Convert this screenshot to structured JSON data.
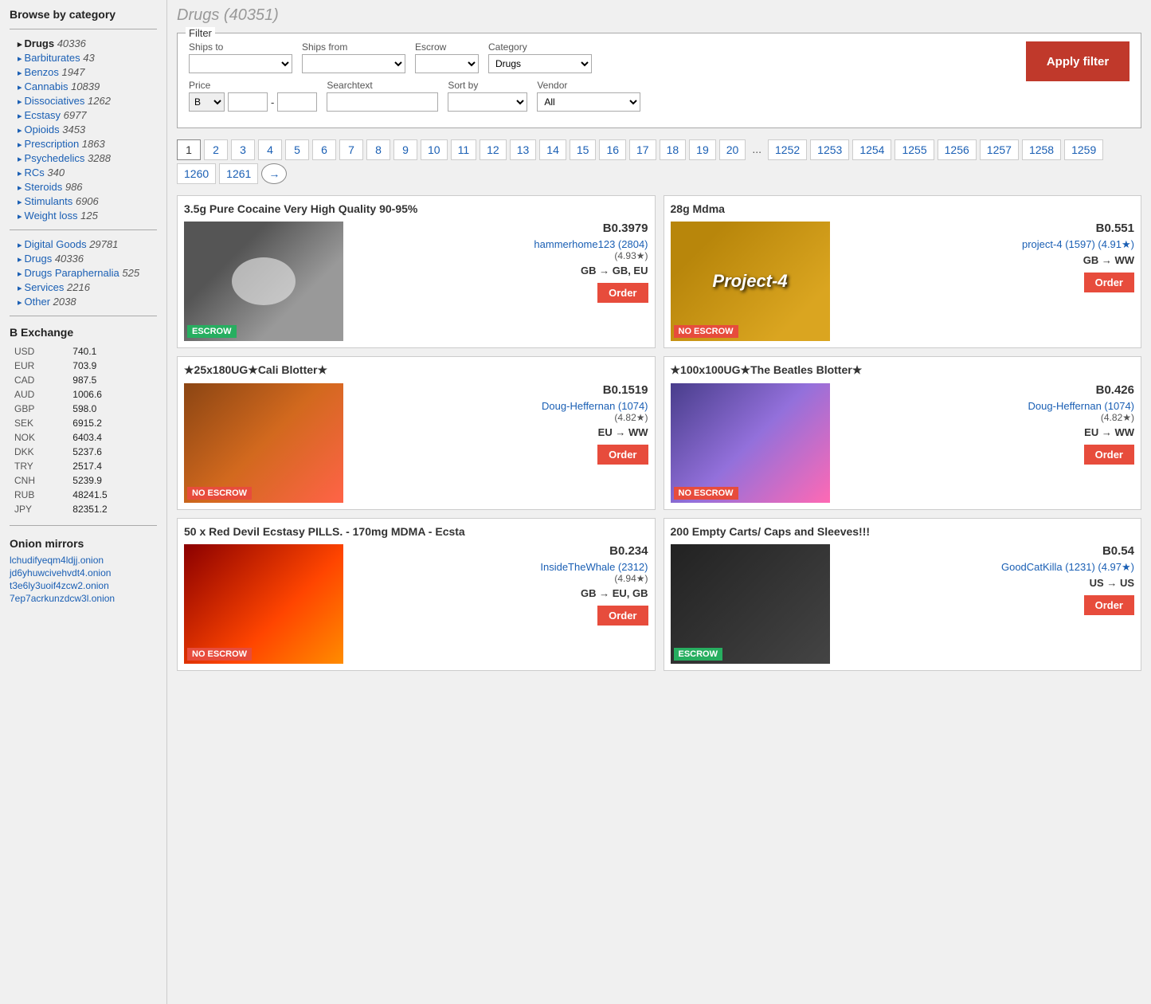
{
  "sidebar": {
    "title": "Browse by category",
    "categories": [
      {
        "label": "Drugs",
        "count": "40336",
        "active": true
      },
      {
        "label": "Barbiturates",
        "count": "43"
      },
      {
        "label": "Benzos",
        "count": "1947"
      },
      {
        "label": "Cannabis",
        "count": "10839"
      },
      {
        "label": "Dissociatives",
        "count": "1262"
      },
      {
        "label": "Ecstasy",
        "count": "6977"
      },
      {
        "label": "Opioids",
        "count": "3453"
      },
      {
        "label": "Prescription",
        "count": "1863"
      },
      {
        "label": "Psychedelics",
        "count": "3288"
      },
      {
        "label": "RCs",
        "count": "340"
      },
      {
        "label": "Steroids",
        "count": "986"
      },
      {
        "label": "Stimulants",
        "count": "6906"
      },
      {
        "label": "Weight loss",
        "count": "125"
      }
    ],
    "main_categories": [
      {
        "label": "Digital Goods",
        "count": "29781"
      },
      {
        "label": "Drugs",
        "count": "40336"
      },
      {
        "label": "Drugs Paraphernalia",
        "count": "525"
      },
      {
        "label": "Services",
        "count": "2216"
      },
      {
        "label": "Other",
        "count": "2038"
      }
    ],
    "exchange": {
      "title": "B Exchange",
      "rates": [
        {
          "currency": "USD",
          "value": "740.1"
        },
        {
          "currency": "EUR",
          "value": "703.9"
        },
        {
          "currency": "CAD",
          "value": "987.5"
        },
        {
          "currency": "AUD",
          "value": "1006.6"
        },
        {
          "currency": "GBP",
          "value": "598.0"
        },
        {
          "currency": "SEK",
          "value": "6915.2"
        },
        {
          "currency": "NOK",
          "value": "6403.4"
        },
        {
          "currency": "DKK",
          "value": "5237.6"
        },
        {
          "currency": "TRY",
          "value": "2517.4"
        },
        {
          "currency": "CNH",
          "value": "5239.9"
        },
        {
          "currency": "RUB",
          "value": "48241.5"
        },
        {
          "currency": "JPY",
          "value": "82351.2"
        }
      ]
    },
    "onion": {
      "title": "Onion mirrors",
      "links": [
        "lchudifyeqm4ldjj.onion",
        "jd6yhuwcivehvdt4.onion",
        "t3e6ly3uoif4zcw2.onion",
        "7ep7acrkunzdcw3l.onion"
      ]
    }
  },
  "main": {
    "page_title": "Drugs (40351)",
    "filter": {
      "legend": "Filter",
      "ships_to_label": "Ships to",
      "ships_from_label": "Ships from",
      "escrow_label": "Escrow",
      "category_label": "Category",
      "category_value": "Drugs",
      "price_label": "Price",
      "price_currency": "B",
      "searchtext_label": "Searchtext",
      "sortby_label": "Sort by",
      "vendor_label": "Vendor",
      "vendor_value": "All",
      "apply_label": "Apply filter"
    },
    "pagination": {
      "pages": [
        "1",
        "2",
        "3",
        "4",
        "5",
        "6",
        "7",
        "8",
        "9",
        "10",
        "11",
        "12",
        "13",
        "14",
        "15",
        "16",
        "17",
        "18",
        "19",
        "20",
        "...",
        "1252",
        "1253",
        "1254",
        "1255",
        "1256",
        "1257",
        "1258",
        "1259",
        "1260",
        "1261"
      ]
    },
    "products": [
      {
        "title": "3.5g Pure Cocaine Very High Quality 90-95%",
        "price": "B0.3979",
        "vendor": "hammerhome123 (2804)",
        "rating": "(4.93★)",
        "shipping": "GB → GB, EU",
        "escrow": "ESCROW",
        "escrow_type": "green",
        "image_bg": "#555"
      },
      {
        "title": "28g Mdma",
        "price": "B0.551",
        "vendor": "project-4 (1597) (4.91★)",
        "rating": "",
        "shipping": "GB → WW",
        "escrow": "NO ESCROW",
        "escrow_type": "red-badge",
        "image_bg": "#b8860b"
      },
      {
        "title": "★25x180UG★Cali Blotter★",
        "price": "B0.1519",
        "vendor": "Doug-Heffernan (1074)",
        "rating": "(4.82★)",
        "shipping": "EU → WW",
        "escrow": "NO ESCROW",
        "escrow_type": "red-badge",
        "image_bg": "#8b4513"
      },
      {
        "title": "★100x100UG★The Beatles Blotter★",
        "price": "B0.426",
        "vendor": "Doug-Heffernan (1074)",
        "rating": "(4.82★)",
        "shipping": "EU → WW",
        "escrow": "NO ESCROW",
        "escrow_type": "red-badge",
        "image_bg": "#6a5acd"
      },
      {
        "title": "50 x Red Devil Ecstasy PILLS. - 170mg MDMA - Ecsta",
        "price": "B0.234",
        "vendor": "InsideTheWhale (2312)",
        "rating": "(4.94★)",
        "shipping": "GB → EU, GB",
        "escrow": "NO ESCROW",
        "escrow_type": "red-badge",
        "image_bg": "#8b0000"
      },
      {
        "title": "200 Empty Carts/ Caps and Sleeves!!!",
        "price": "B0.54",
        "vendor": "GoodCatKilla (1231) (4.97★)",
        "rating": "",
        "shipping": "US → US",
        "escrow": "ESCROW",
        "escrow_type": "green",
        "image_bg": "#222"
      }
    ]
  }
}
